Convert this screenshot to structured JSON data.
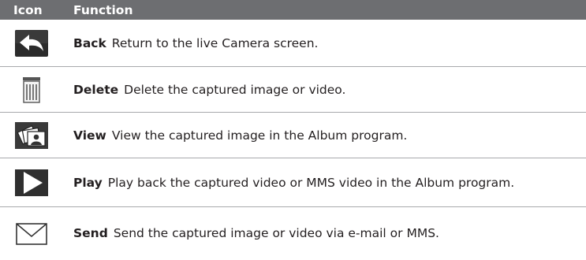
{
  "header": {
    "icon_label": "Icon",
    "function_label": "Function"
  },
  "rows": [
    {
      "icon": "back-arrow-icon",
      "name": "Back",
      "desc": "Return to the live Camera screen."
    },
    {
      "icon": "trash-icon",
      "name": "Delete",
      "desc": "Delete the captured image or video."
    },
    {
      "icon": "photos-icon",
      "name": "View",
      "desc": "View the captured image in the Album program."
    },
    {
      "icon": "play-icon",
      "name": "Play",
      "desc": "Play back the captured video or MMS video in the Album program."
    },
    {
      "icon": "envelope-icon",
      "name": "Send",
      "desc": "Send the captured image or video via e-mail or MMS."
    }
  ]
}
